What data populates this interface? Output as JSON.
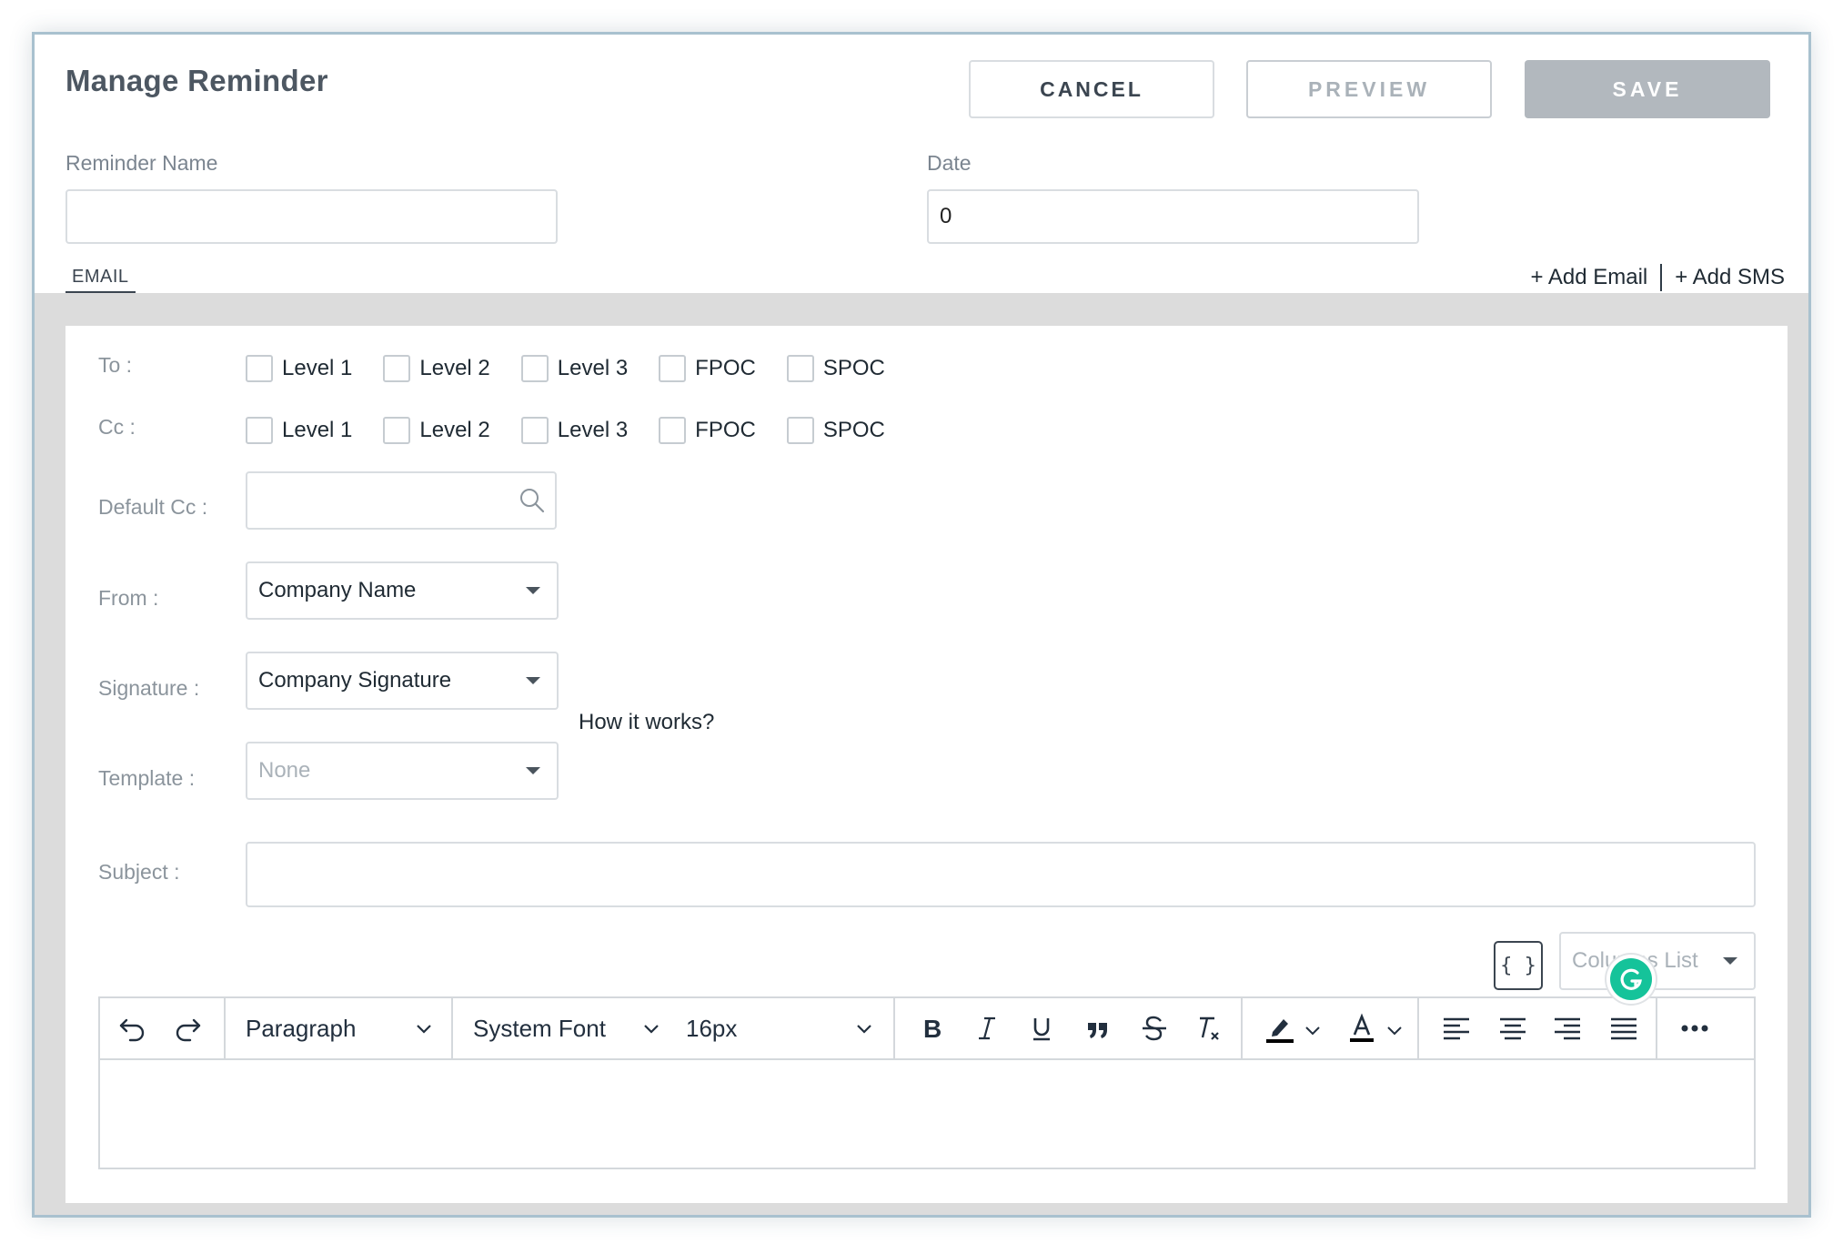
{
  "dialog": {
    "title": "Manage Reminder",
    "buttons": {
      "cancel": "CANCEL",
      "preview": "PREVIEW",
      "save": "SAVE"
    }
  },
  "form": {
    "reminder_name_label": "Reminder Name",
    "reminder_name_value": "",
    "date_label": "Date",
    "date_value": "0"
  },
  "tabs": {
    "email": "EMAIL"
  },
  "actions": {
    "add_email": "+ Add Email",
    "add_sms": "+ Add SMS"
  },
  "email": {
    "to_label": "To :",
    "to_options": [
      "Level 1",
      "Level 2",
      "Level 3",
      "FPOC",
      "SPOC"
    ],
    "cc_label": "Cc :",
    "cc_options": [
      "Level 1",
      "Level 2",
      "Level 3",
      "FPOC",
      "SPOC"
    ],
    "default_cc_label": "Default Cc :",
    "from_label": "From :",
    "from_value": "Company Name",
    "signature_label": "Signature :",
    "signature_value": "Company Signature",
    "how_it_works": "How it works?",
    "template_label": "Template :",
    "template_value": "None",
    "subject_label": "Subject :",
    "subject_value": "",
    "placeholder_button": "{ }",
    "columns_list": "Columns List"
  },
  "editor": {
    "block_format": "Paragraph",
    "font_family": "System Font",
    "font_size": "16px",
    "tools": [
      "undo-icon",
      "redo-icon",
      "bold-icon",
      "italic-icon",
      "underline-icon",
      "blockquote-icon",
      "strikethrough-icon",
      "clear-format-icon",
      "highlight-color-icon",
      "text-color-icon",
      "align-left-icon",
      "align-center-icon",
      "align-right-icon",
      "align-justify-icon",
      "more-icon"
    ]
  },
  "colors": {
    "save_disabled": "#b2b8be",
    "grammarly": "#15c39a",
    "border": "#d9dde1"
  }
}
